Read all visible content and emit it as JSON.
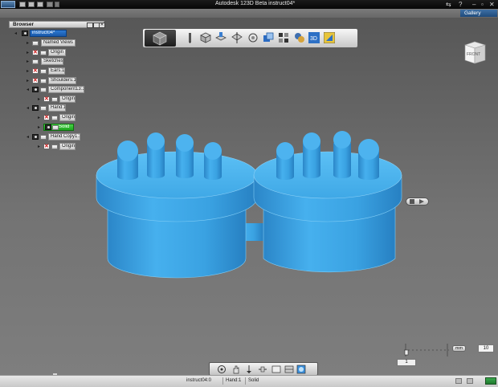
{
  "window": {
    "title": "Autodesk 123D Beta   instruct04*",
    "gallery_label": "Gallery",
    "help_glyph": "?"
  },
  "browser": {
    "title": "Browser",
    "root": "instruct04*",
    "items": [
      {
        "label": "Named Views"
      },
      {
        "label": "Origin"
      },
      {
        "label": "Sketches"
      },
      {
        "label": "Ears:1"
      },
      {
        "label": "Shoulders:1"
      },
      {
        "label": "Component13:1"
      },
      {
        "label": "Origin"
      },
      {
        "label": "Hand:1"
      },
      {
        "label": "Origin"
      },
      {
        "label": "Solid"
      },
      {
        "label": "Hand Copy1:1"
      },
      {
        "label": "Origin"
      }
    ]
  },
  "toolbar": {
    "icons": [
      "pencil-icon",
      "box-icon",
      "extrude-icon",
      "modify-icon",
      "pattern-icon",
      "group-icon",
      "grid-icon",
      "material-icon",
      "3d-icon",
      "measure-icon"
    ]
  },
  "viewcube": {
    "face": "FRONT"
  },
  "grid": {
    "units": "mm",
    "value": "10",
    "snap": "1"
  },
  "nav": {
    "icons": [
      "orbit-icon",
      "pan-icon",
      "zoom-icon",
      "fit-icon",
      "view-icon",
      "display-icon",
      "visual-style-icon"
    ]
  },
  "status": {
    "document": "instruct04:0",
    "selection": "Hand:1",
    "type": "Solid"
  },
  "colors": {
    "model": "#3a9fdc",
    "root_highlight": "#1d63b8",
    "solid_highlight": "#2bb52b"
  }
}
